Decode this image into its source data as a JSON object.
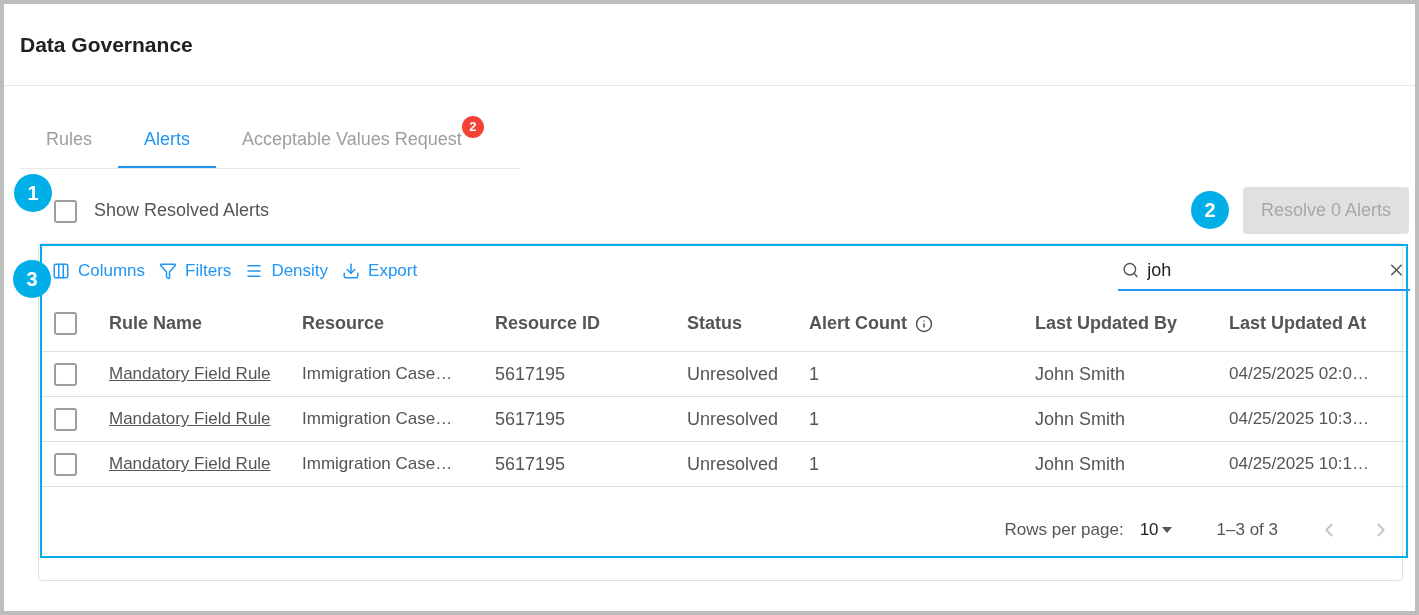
{
  "page_title": "Data Governance",
  "tabs": [
    {
      "label": "Rules",
      "selected": false
    },
    {
      "label": "Alerts",
      "selected": true
    },
    {
      "label": "Acceptable Values Request",
      "selected": false,
      "badge": "2"
    }
  ],
  "show_resolved": {
    "label": "Show Resolved Alerts",
    "checked": false
  },
  "resolve_button": {
    "label": "Resolve 0 Alerts",
    "disabled": true
  },
  "toolbar": [
    {
      "kind": "columns",
      "label": "Columns"
    },
    {
      "kind": "filters",
      "label": "Filters"
    },
    {
      "kind": "density",
      "label": "Density"
    },
    {
      "kind": "export",
      "label": "Export"
    }
  ],
  "search": {
    "value": "joh"
  },
  "table": {
    "select_all_checked": false,
    "columns": [
      "Rule Name",
      "Resource",
      "Resource ID",
      "Status",
      "Alert Count",
      "Last Updated By",
      "Last Updated At"
    ],
    "rows": [
      {
        "checked": false,
        "cells": [
          "Mandatory Field Rule",
          "Immigration Case…",
          "5617195",
          "Unresolved",
          "1",
          "John Smith",
          "04/25/2025 02:0…"
        ]
      },
      {
        "checked": false,
        "cells": [
          "Mandatory Field Rule",
          "Immigration Case…",
          "5617195",
          "Unresolved",
          "1",
          "John Smith",
          "04/25/2025 10:3…"
        ]
      },
      {
        "checked": false,
        "cells": [
          "Mandatory Field Rule",
          "Immigration Case…",
          "5617195",
          "Unresolved",
          "1",
          "John Smith",
          "04/25/2025 10:1…"
        ]
      }
    ]
  },
  "pagination": {
    "rows_per_page_label": "Rows per page:",
    "rows_per_page": "10",
    "range": "1–3 of 3"
  },
  "annotations": [
    "1",
    "2",
    "3"
  ]
}
